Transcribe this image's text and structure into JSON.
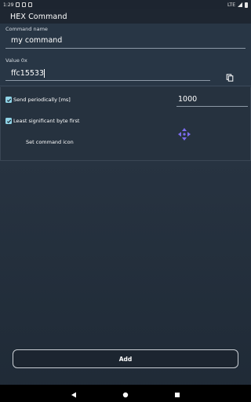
{
  "status_bar": {
    "time": "1:29",
    "network": "LTE"
  },
  "app_bar": {
    "title": "HEX Command"
  },
  "form": {
    "command_name_label": "Command name",
    "command_name_value": "my command",
    "value_label": "Value  0x",
    "value_value": "ffc15533"
  },
  "options": {
    "send_periodically_label": "Send periodically [ms]",
    "send_periodically_checked": true,
    "period_value": "1000",
    "lsb_first_label": "Least significant byte first",
    "lsb_first_checked": true,
    "set_icon_label": "Set command icon"
  },
  "actions": {
    "add_label": "Add"
  },
  "colors": {
    "accent_checkbox": "#8fd3e6",
    "icon_purple": "#7b6cf0"
  },
  "icons": {
    "copy": "copy-icon",
    "command_icon": "move-arrows-icon",
    "nav_back": "back-triangle-icon",
    "nav_home": "home-circle-icon",
    "nav_recent": "recent-square-icon"
  }
}
